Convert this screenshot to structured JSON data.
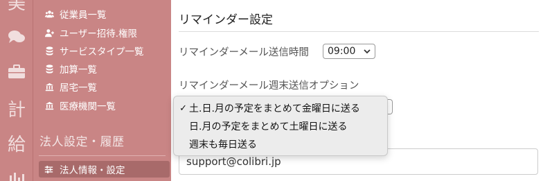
{
  "rail": {
    "icons": [
      {
        "name": "char-mi",
        "glyph": "美"
      },
      {
        "name": "chat-bubbles-icon",
        "glyph": ""
      },
      {
        "name": "briefcase-icon",
        "glyph": ""
      },
      {
        "name": "char-kei",
        "glyph": "計"
      },
      {
        "name": "char-kyu",
        "glyph": "給"
      },
      {
        "name": "bar-chart-icon",
        "glyph": ""
      }
    ]
  },
  "sidebar": {
    "items": [
      {
        "label": "従業員一覧",
        "icon": "users-icon"
      },
      {
        "label": "ユーザー招待.権限",
        "icon": "user-plus-icon"
      },
      {
        "label": "サービスタイプ一覧",
        "icon": "database-icon"
      },
      {
        "label": "加算一覧",
        "icon": "database-icon"
      },
      {
        "label": "居宅一覧",
        "icon": "building-icon"
      },
      {
        "label": "医療機関一覧",
        "icon": "building-icon"
      }
    ],
    "section_title": "法人設定・履歴",
    "active_item": {
      "label": "法人情報・設定",
      "icon": "sliders-icon"
    }
  },
  "main": {
    "title": "リマインダー設定",
    "send_time_label": "リマインダーメール送信時間",
    "send_time_value": "09:00",
    "weekend_option_label": "リマインダーメール週末送信オプション",
    "email_value": "support@colibri.jp"
  },
  "dropdown": {
    "options": [
      {
        "label": "土.日.月の予定をまとめて金曜日に送る",
        "selected": true
      },
      {
        "label": "日.月の予定をまとめて土曜日に送る",
        "selected": false
      },
      {
        "label": "週末も毎日送る",
        "selected": false
      }
    ],
    "check_glyph": "✓"
  },
  "colors": {
    "sidebar_bg": "#c98585",
    "active_item_bg": "#a86a6a",
    "dropdown_bg": "#ececec"
  }
}
